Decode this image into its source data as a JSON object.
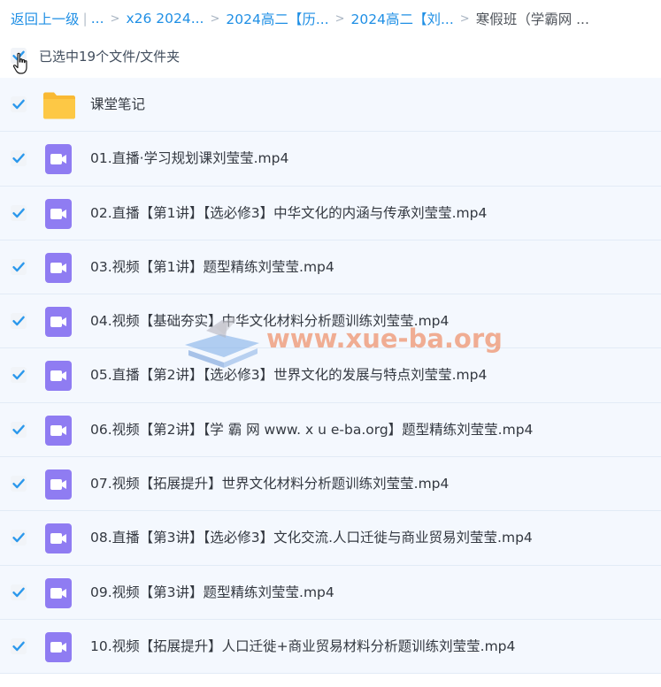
{
  "breadcrumb": {
    "back_label": "返回上一级",
    "separator_bar": "|",
    "ellipsis": "...",
    "items": [
      "x26 2024...",
      "2024高二【历...",
      "2024高二【刘...",
      "寒假班（学霸网 ..."
    ]
  },
  "selection": {
    "text": "已选中19个文件/文件夹"
  },
  "files": [
    {
      "name": "课堂笔记",
      "type": "folder-icon"
    },
    {
      "name": "01.直播·学习规划课刘莹莹.mp4",
      "type": "video-icon"
    },
    {
      "name": "02.直播【第1讲】【选必修3】中华文化的内涵与传承刘莹莹.mp4",
      "type": "video-icon"
    },
    {
      "name": "03.视频【第1讲】题型精练刘莹莹.mp4",
      "type": "video-icon"
    },
    {
      "name": "04.视频【基础夯实】中华文化材料分析题训练刘莹莹.mp4",
      "type": "video-icon"
    },
    {
      "name": "05.直播【第2讲】【选必修3】世界文化的发展与特点刘莹莹.mp4",
      "type": "video-icon"
    },
    {
      "name": "06.视频【第2讲】【学 霸 网 www. x u e-ba.org】题型精练刘莹莹.mp4",
      "type": "video-icon"
    },
    {
      "name": "07.视频【拓展提升】世界文化材料分析题训练刘莹莹.mp4",
      "type": "video-icon"
    },
    {
      "name": "08.直播【第3讲】【选必修3】文化交流.人口迁徙与商业贸易刘莹莹.mp4",
      "type": "video-icon"
    },
    {
      "name": "09.视频【第3讲】题型精练刘莹莹.mp4",
      "type": "video-icon"
    },
    {
      "name": "10.视频【拓展提升】人口迁徙+商业贸易材料分析题训练刘莹莹.mp4",
      "type": "video-icon"
    }
  ],
  "watermark": {
    "text": "www.xue-ba.org"
  },
  "colors": {
    "link": "#1f8fe5",
    "check": "#2b98ec",
    "row_bg": "#f4f8fe",
    "video_icon": "#8f7cf2",
    "folder": "#fcc53a"
  }
}
